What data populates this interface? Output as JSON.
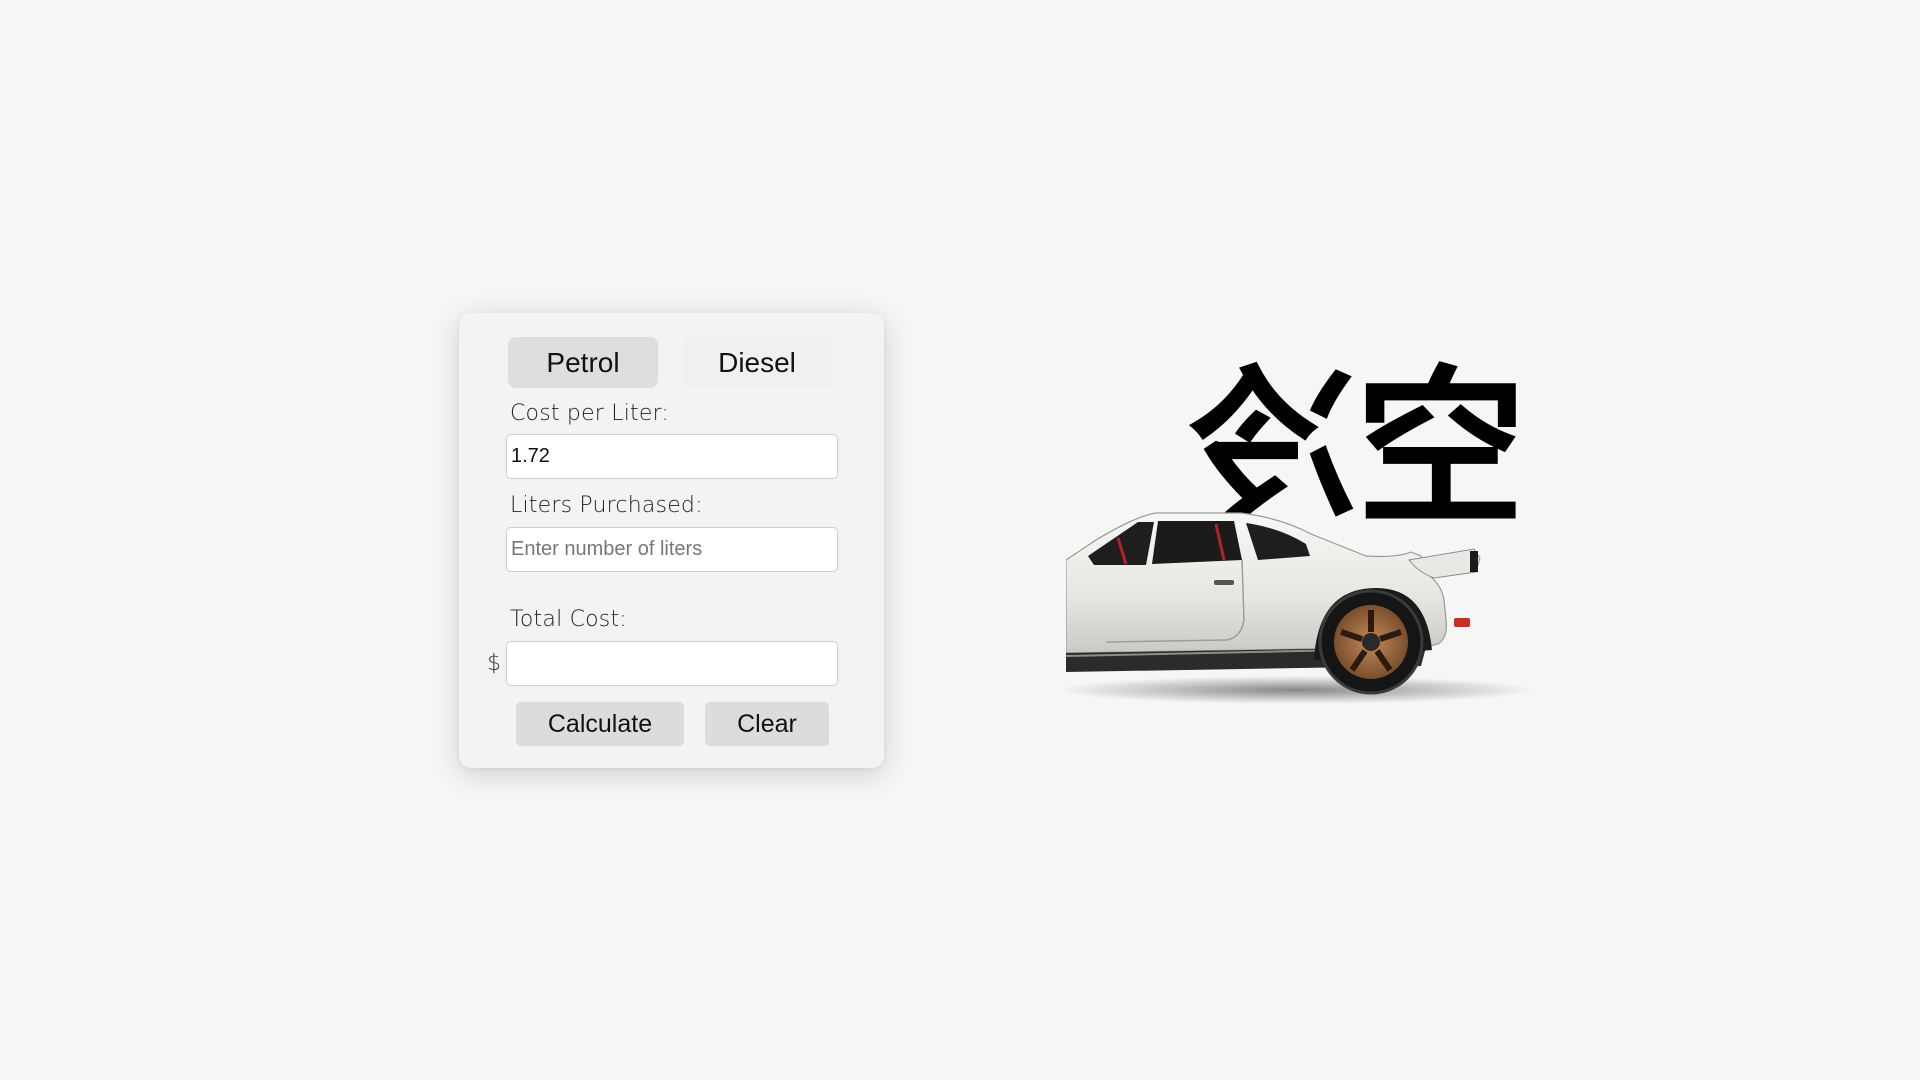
{
  "calculator": {
    "tabs": [
      {
        "label": "Petrol",
        "active": true
      },
      {
        "label": "Diesel",
        "active": false
      }
    ],
    "cost_per_liter": {
      "label": "Cost per Liter:",
      "value": "1.72"
    },
    "liters_purchased": {
      "label": "Liters Purchased:",
      "value": "",
      "placeholder": "Enter number of liters"
    },
    "total_cost": {
      "label": "Total Cost:",
      "currency": "$",
      "value": ""
    },
    "buttons": {
      "calculate": "Calculate",
      "clear": "Clear"
    }
  },
  "artwork": {
    "kanji_text": "空冷",
    "car_color": "#ececec",
    "accent_color": "#000000"
  },
  "colors": {
    "page_background": "#f6f6f6",
    "card_background": "#f3f3f3",
    "active_tab": "#dedede",
    "button_background": "#dcdcdc"
  }
}
